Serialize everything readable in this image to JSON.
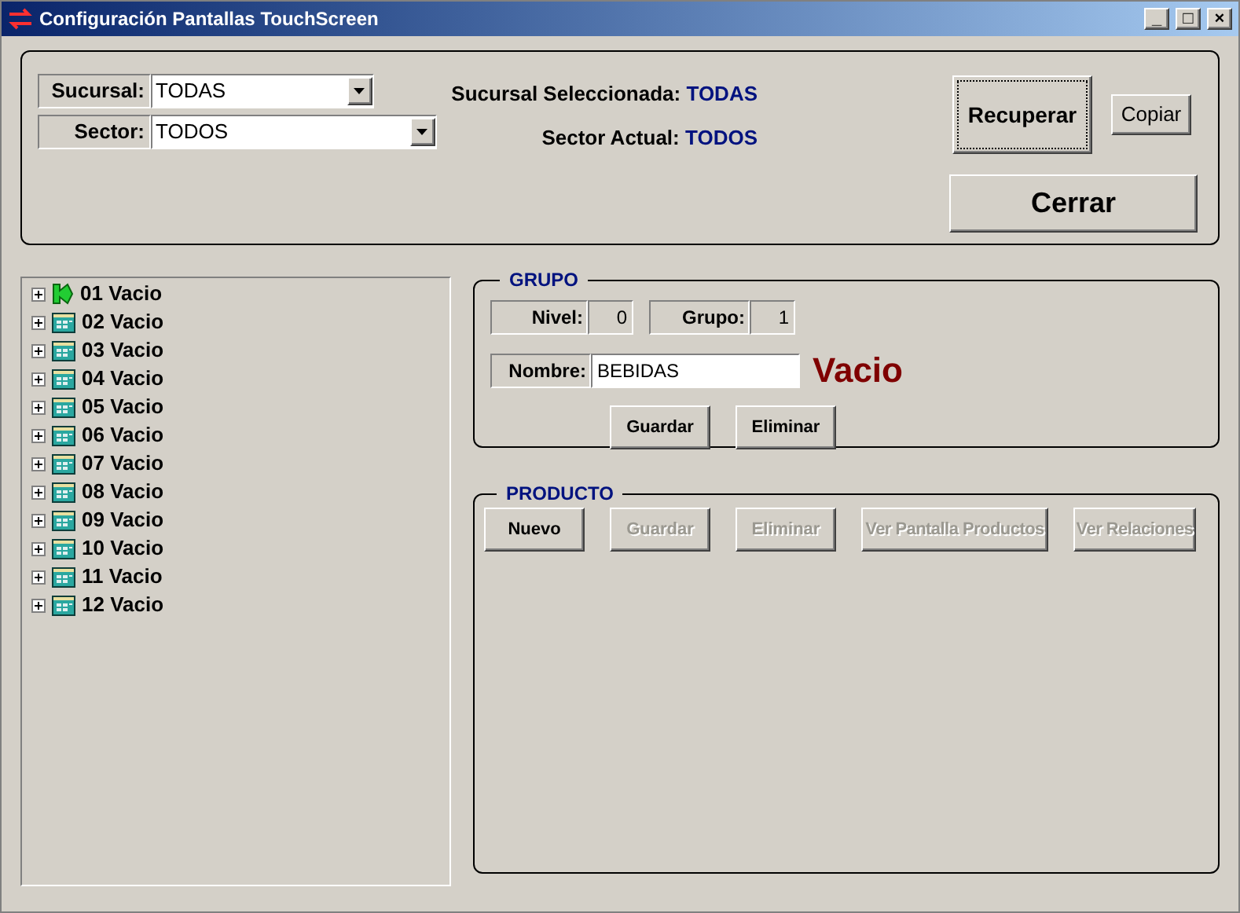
{
  "window": {
    "title": "Configuración Pantallas TouchScreen",
    "controls": [
      "_",
      "□",
      "×"
    ]
  },
  "filters": [
    {
      "label": "Sucursal:",
      "value": "TODAS",
      "status_label": "Sucursal Seleccionada:",
      "status_value": "TODAS"
    },
    {
      "label": "Sector:",
      "value": "TODOS",
      "status_label": "Sector Actual:",
      "status_value": "TODOS"
    }
  ],
  "actions": {
    "recuperar": "Recuperar",
    "copiar": "Copiar",
    "cerrar": "Cerrar"
  },
  "tree": [
    {
      "label": "01 Vacio",
      "kind": "arrow"
    },
    {
      "label": "02 Vacio",
      "kind": "screen"
    },
    {
      "label": "03 Vacio",
      "kind": "screen"
    },
    {
      "label": "04 Vacio",
      "kind": "screen"
    },
    {
      "label": "05 Vacio",
      "kind": "screen"
    },
    {
      "label": "06 Vacio",
      "kind": "screen"
    },
    {
      "label": "07 Vacio",
      "kind": "screen"
    },
    {
      "label": "08 Vacio",
      "kind": "screen"
    },
    {
      "label": "09 Vacio",
      "kind": "screen"
    },
    {
      "label": "10 Vacio",
      "kind": "screen"
    },
    {
      "label": "11 Vacio",
      "kind": "screen"
    },
    {
      "label": "12 Vacio",
      "kind": "screen"
    }
  ],
  "grupo": {
    "title": "GRUPO",
    "nivel_label": "Nivel:",
    "nivel": "0",
    "grupo_label": "Grupo:",
    "grupo": "1",
    "nombre_label": "Nombre:",
    "nombre": "BEBIDAS",
    "status": "Vacio",
    "buttons": [
      {
        "label": "Guardar",
        "disabled": false
      },
      {
        "label": "Eliminar",
        "disabled": false
      }
    ]
  },
  "producto": {
    "title": "PRODUCTO",
    "buttons": [
      {
        "label": "Nuevo",
        "disabled": false
      },
      {
        "label": "Guardar",
        "disabled": true
      },
      {
        "label": "Eliminar",
        "disabled": true
      },
      {
        "label": "Ver Pantalla Productos",
        "disabled": true
      },
      {
        "label": "Ver Relaciones",
        "disabled": true
      }
    ]
  }
}
